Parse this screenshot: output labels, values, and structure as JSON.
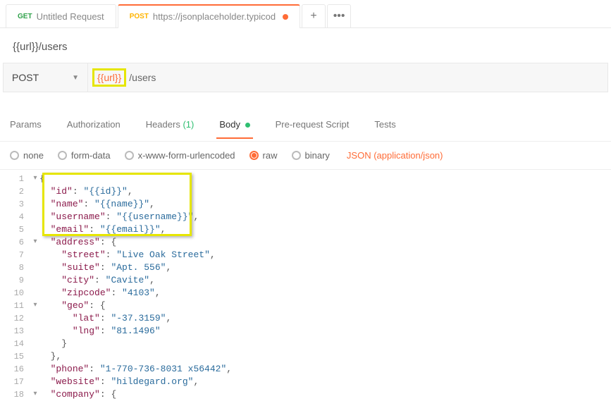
{
  "tabs": [
    {
      "method": "GET",
      "method_class": "get",
      "title": "Untitled Request",
      "dirty": false,
      "active": false
    },
    {
      "method": "POST",
      "method_class": "post",
      "title": "https://jsonplaceholder.typicod",
      "dirty": true,
      "active": true
    }
  ],
  "request_name": "{{url}}/users",
  "method": "POST",
  "url_var": "{{url}}",
  "url_path": "/users",
  "req_tabs": {
    "params": "Params",
    "auth": "Authorization",
    "headers": "Headers",
    "headers_count": "(1)",
    "body": "Body",
    "prereq": "Pre-request Script",
    "tests": "Tests"
  },
  "body_types": {
    "none": "none",
    "formdata": "form-data",
    "xwww": "x-www-form-urlencoded",
    "raw": "raw",
    "binary": "binary",
    "dropdown": "JSON (application/json)"
  },
  "code": {
    "l1": "{",
    "l2": "  \"id\": \"{{id}}\",",
    "l3": "  \"name\": \"{{name}}\",",
    "l4": "  \"username\": \"{{username}}\",",
    "l5": "  \"email\": \"{{email}}\",",
    "l6": "  \"address\": {",
    "l7": "    \"street\": \"Live Oak Street\",",
    "l8": "    \"suite\": \"Apt. 556\",",
    "l9": "    \"city\": \"Cavite\",",
    "l10": "    \"zipcode\": \"4103\",",
    "l11": "    \"geo\": {",
    "l12": "      \"lat\": \"-37.3159\",",
    "l13": "      \"lng\": \"81.1496\"",
    "l14": "    }",
    "l15": "  },",
    "l16": "  \"phone\": \"1-770-736-8031 x56442\",",
    "l17": "  \"website\": \"hildegard.org\",",
    "l18": "  \"company\": {"
  },
  "line_numbers": [
    "1",
    "2",
    "3",
    "4",
    "5",
    "6",
    "7",
    "8",
    "9",
    "10",
    "11",
    "12",
    "13",
    "14",
    "15",
    "16",
    "17",
    "18"
  ],
  "fold_lines": [
    1,
    6,
    11,
    18
  ]
}
